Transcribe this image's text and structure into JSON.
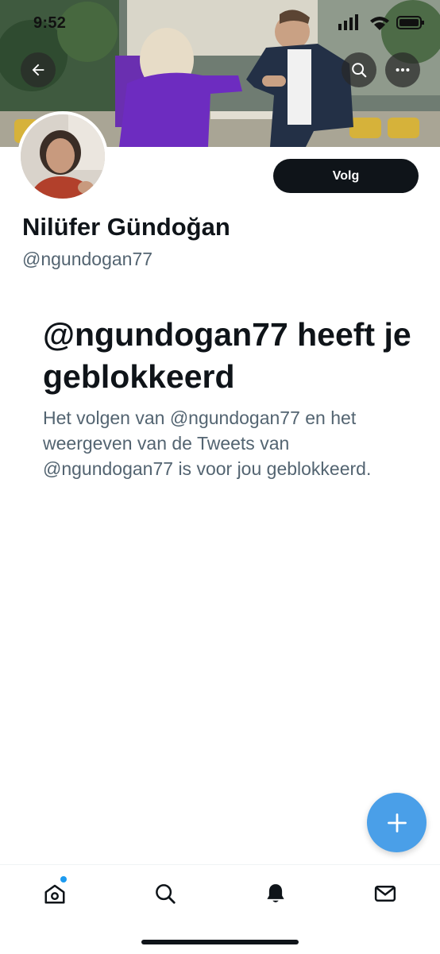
{
  "status_bar": {
    "time": "9:52"
  },
  "profile": {
    "display_name": "Nilüfer Gündoğan",
    "handle": "@ngundogan77",
    "follow_label": "Volg"
  },
  "blocked": {
    "title": "@ngundogan77 heeft je geblokkeerd",
    "description": "Het volgen van @ngundogan77 en het weergeven van de Tweets van @ngundogan77 is voor jou geblokkeerd."
  },
  "icons": {
    "back": "arrow-left-icon",
    "search": "search-icon",
    "more": "more-icon",
    "compose": "plus-icon",
    "tab_home": "home-icon",
    "tab_search": "search-icon",
    "tab_notifications": "bell-icon",
    "tab_messages": "mail-icon"
  },
  "colors": {
    "primary_text": "#0f1419",
    "secondary_text": "#536471",
    "accent": "#1d9bf0",
    "fab": "#4a9fe8"
  }
}
